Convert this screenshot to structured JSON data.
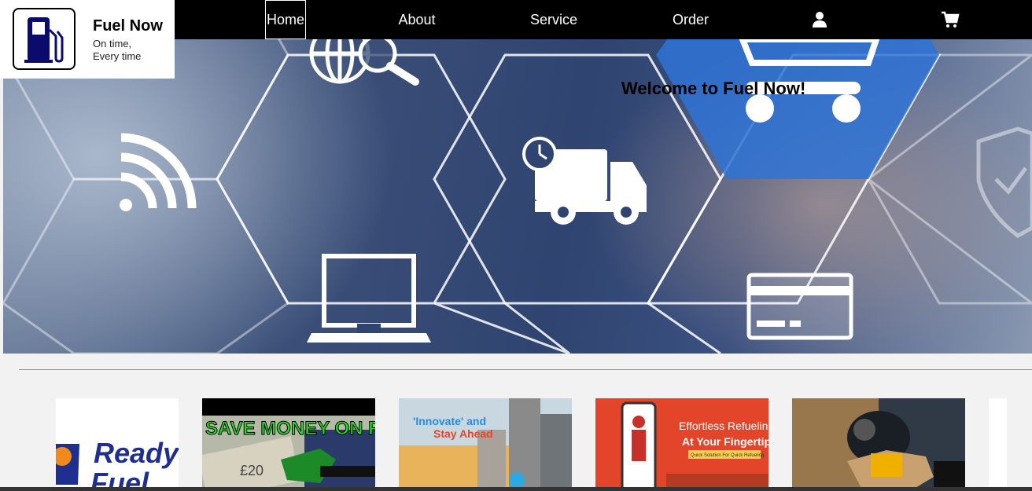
{
  "brand": {
    "name": "Fuel Now",
    "tagline_line1": "On time,",
    "tagline_line2": "Every time",
    "logo_icon": "fuel-pump-icon",
    "logo_color": "#0b0b6e"
  },
  "nav": {
    "items": [
      "Home",
      "About",
      "Service",
      "Order"
    ],
    "active": "Home",
    "icons": [
      "user-icon",
      "cart-icon"
    ]
  },
  "hero": {
    "welcome": "Welcome to Fuel Now!",
    "icons": [
      "globe-search-icon",
      "wifi-icon",
      "delivery-truck-icon",
      "laptop-icon",
      "shopping-cart-icon",
      "credit-card-icon",
      "shield-check-icon"
    ]
  },
  "gallery": {
    "cards": [
      {
        "title_line1": "Ready",
        "title_line2": "Fuel"
      },
      {
        "caption": "SAVE MONEY ON FUEL",
        "note_label": "£20"
      },
      {
        "caption_line1": "'Innovate' and",
        "caption_line2": "Stay Ahead"
      },
      {
        "caption_line1": "Effortless Refueling",
        "caption_line2": "At Your Fingertips",
        "caption_line3": "Quick Solution For Quick Refueling"
      },
      {
        "caption": ""
      }
    ]
  },
  "colors": {
    "navbar_bg": "#000000",
    "nav_text": "#ffffff",
    "page_bg": "#f2f2f2",
    "ready_fuel_blue": "#1f2f8f",
    "save_money_green": "#22dd22",
    "refuel_orange": "#e2452a"
  }
}
